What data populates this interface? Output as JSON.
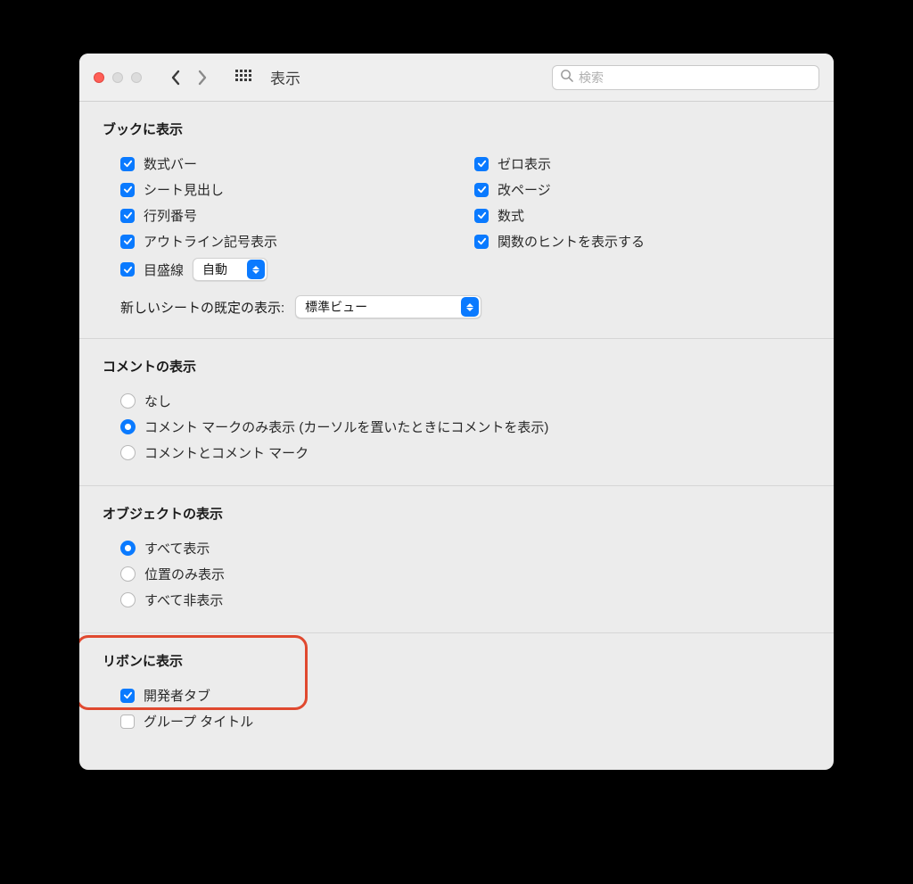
{
  "toolbar": {
    "title": "表示",
    "searchPlaceholder": "検索"
  },
  "sections": {
    "book": {
      "title": "ブックに表示",
      "left": {
        "formula_bar": "数式バー",
        "sheet_tabs": "シート見出し",
        "row_col_numbers": "行列番号",
        "outline_symbols": "アウトライン記号表示",
        "gridlines": "目盛線"
      },
      "right": {
        "zero_display": "ゼロ表示",
        "page_breaks": "改ページ",
        "formulas": "数式",
        "function_hints": "関数のヒントを表示する"
      },
      "gridlines_popup": "自動",
      "default_view_label": "新しいシートの既定の表示:",
      "default_view_value": "標準ビュー"
    },
    "comments": {
      "title": "コメントの表示",
      "none": "なし",
      "marks_only": "コメント マークのみ表示 (カーソルを置いたときにコメントを表示)",
      "both": "コメントとコメント マーク"
    },
    "objects": {
      "title": "オブジェクトの表示",
      "all": "すべて表示",
      "position": "位置のみ表示",
      "hide": "すべて非表示"
    },
    "ribbon": {
      "title": "リボンに表示",
      "developer": "開発者タブ",
      "group_titles": "グループ タイトル"
    }
  }
}
